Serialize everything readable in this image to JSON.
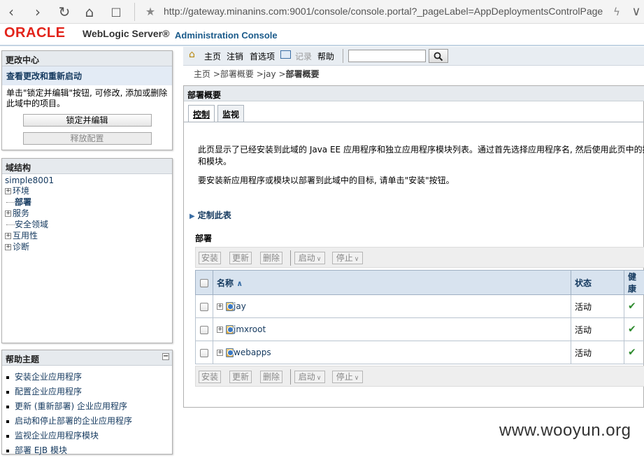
{
  "browser": {
    "url": "http://gateway.minanins.com:9001/console/console.portal?_pageLabel=AppDeploymentsControlPage"
  },
  "header": {
    "logo": "ORACLE",
    "product": "WebLogic Server®",
    "subtitle": "Administration Console"
  },
  "change_center": {
    "title": "更改中心",
    "subtitle": "查看更改和重新启动",
    "description": "单击\"锁定并编辑\"按钮, 可修改, 添加或删除此域中的项目。",
    "lock_button": "锁定并编辑",
    "release_button": "释放配置"
  },
  "domain_structure": {
    "title": "域结构",
    "root": "simple8001",
    "items": [
      {
        "label": "环境",
        "expandable": true
      },
      {
        "label": "部署",
        "expandable": false
      },
      {
        "label": "服务",
        "expandable": true
      },
      {
        "label": "安全领域",
        "expandable": false
      },
      {
        "label": "互用性",
        "expandable": true
      },
      {
        "label": "诊断",
        "expandable": true
      }
    ]
  },
  "help_topics": {
    "title": "帮助主题",
    "items": [
      "安装企业应用程序",
      "配置企业应用程序",
      "更新 (重新部署) 企业应用程序",
      "启动和停止部署的企业应用程序",
      "监视企业应用程序模块",
      "部署 EJB 模块"
    ]
  },
  "toolbar": {
    "home": "主页",
    "logout": "注销",
    "preferences": "首选项",
    "record": "记录",
    "help": "帮助",
    "search_value": ""
  },
  "breadcrumb": {
    "items": [
      "主页",
      "部署概要",
      "jay"
    ],
    "current": "部署概要"
  },
  "main": {
    "title": "部署概要",
    "tabs": [
      "控制",
      "监视"
    ],
    "active_tab": "控制",
    "description_1a": "此页显示了已经安装到此域的 Java EE 应用程序和独立应用程序模块列表。通过首先选择应用程序名, 然后使用此页中的控",
    "description_1b": "和模块。",
    "description_2": "要安装新应用程序或模块以部署到此域中的目标, 请单击\"安装\"按钮。",
    "customize": "定制此表",
    "table_label": "部署"
  },
  "actions": {
    "install": "安装",
    "update": "更新",
    "delete": "删除",
    "start": "启动",
    "stop": "停止"
  },
  "table": {
    "columns": {
      "name": "名称",
      "state": "状态",
      "health": "健康"
    },
    "rows": [
      {
        "name": "jay",
        "state": "活动",
        "health": "OK"
      },
      {
        "name": "jmxroot",
        "state": "活动",
        "health": "OK"
      },
      {
        "name": "webapps",
        "state": "活动",
        "health": "OK"
      }
    ]
  },
  "watermark": "www.wooyun.org",
  "icons": [
    "back-icon",
    "forward-icon",
    "reload-icon",
    "home-icon",
    "reader-icon",
    "star-icon",
    "bolt-icon",
    "search-icon",
    "record-icon",
    "sort-asc-icon",
    "ok-check-icon"
  ]
}
